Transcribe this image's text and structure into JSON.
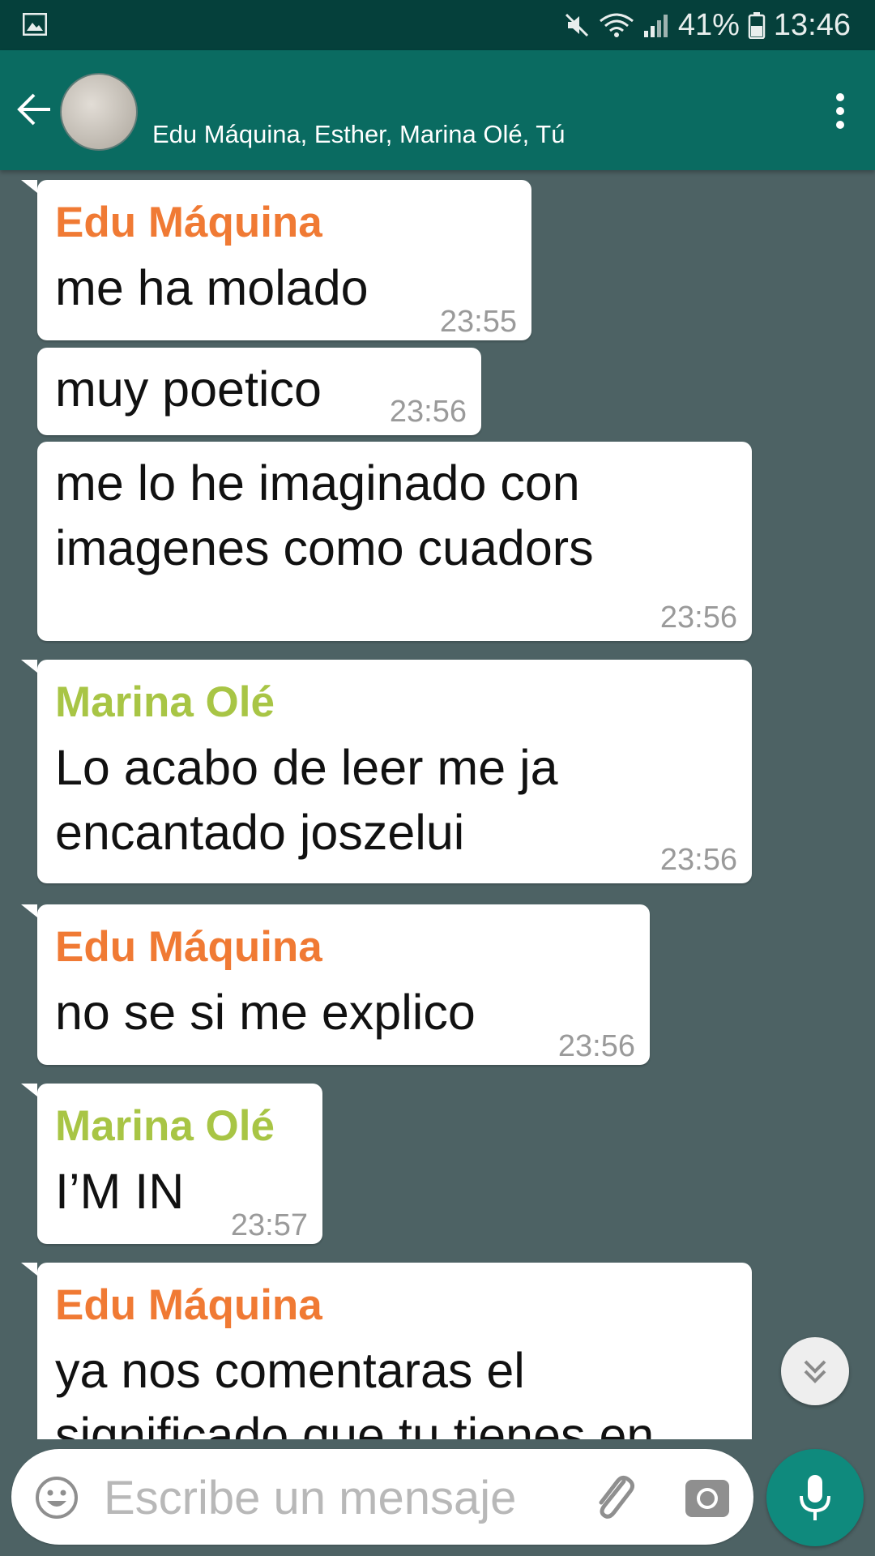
{
  "status_bar": {
    "battery": "41%",
    "time": "13:46",
    "icons": [
      "gallery-icon",
      "mute-icon",
      "wifi-icon",
      "signal-icon",
      "battery-icon"
    ]
  },
  "header": {
    "participants": "Edu Máquina, Esther, Marina Olé, Tú",
    "icons": [
      "back-arrow-icon",
      "group-avatar",
      "more-vert-icon"
    ]
  },
  "colors": {
    "header_bg": "#0a6b61",
    "status_bg": "#05403b",
    "chat_bg": "#4d6264",
    "edu_name": "#f07a34",
    "marina_name": "#a8c545",
    "mic_button": "#0f8a7d"
  },
  "messages": [
    {
      "sender": "Edu Máquina",
      "lines": [
        "me ha molado"
      ],
      "time": "23:55"
    },
    {
      "lines": [
        "muy poetico"
      ],
      "time": "23:56"
    },
    {
      "lines": [
        "me lo he imaginado con",
        "imagenes como cuadors"
      ],
      "time": "23:56"
    },
    {
      "sender": "Marina Olé",
      "lines": [
        "Lo acabo de leer me ja",
        "encantado joszelui"
      ],
      "time": "23:56"
    },
    {
      "sender": "Edu Máquina",
      "lines": [
        "no se si me explico"
      ],
      "time": "23:56"
    },
    {
      "sender": "Marina Olé",
      "lines": [
        "I’M IN"
      ],
      "time": "23:57"
    },
    {
      "sender": "Edu Máquina",
      "lines": [
        "ya nos comentaras el",
        "significado que tu tienes en"
      ],
      "time": ""
    }
  ],
  "composer": {
    "placeholder": "Escribe un mensaje",
    "icons": [
      "emoji-icon",
      "attach-icon",
      "camera-icon",
      "mic-icon"
    ]
  }
}
